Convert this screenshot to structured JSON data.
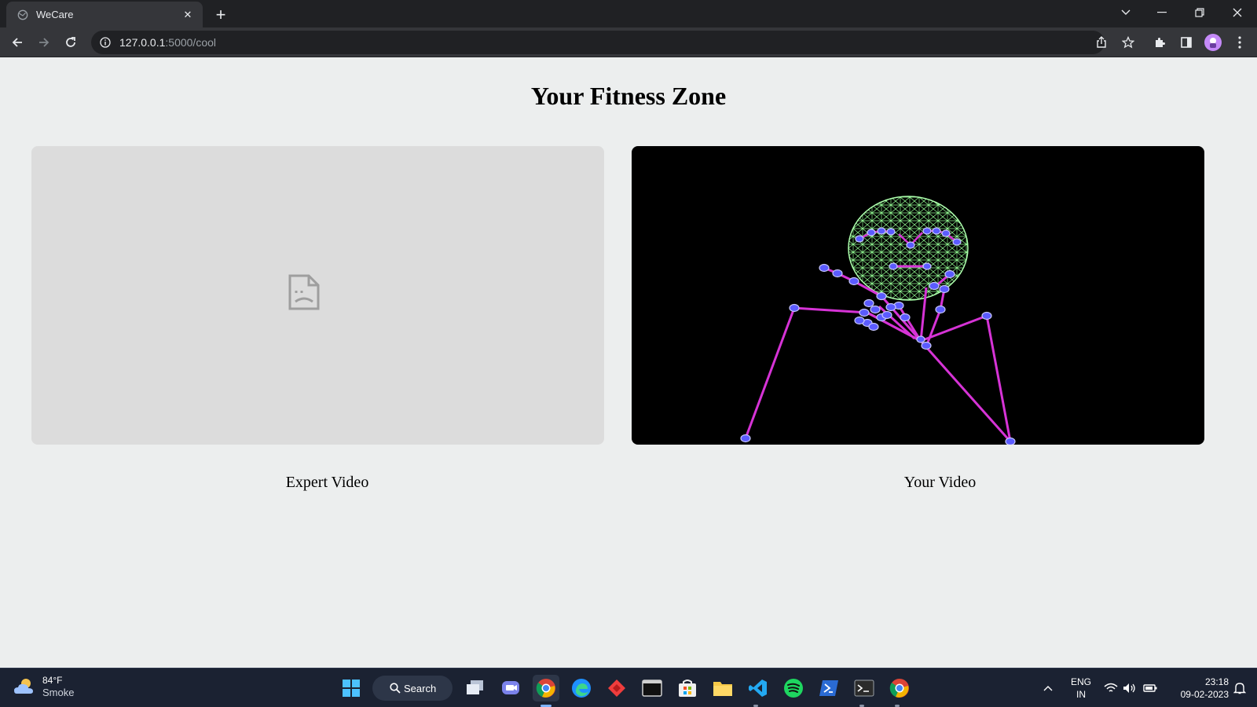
{
  "browser": {
    "tab_title": "WeCare",
    "url_host": "127.0.0.1",
    "url_path": ":5000/cool"
  },
  "page": {
    "title": "Your Fitness Zone",
    "panels": [
      {
        "caption": "Expert Video"
      },
      {
        "caption": "Your Video"
      }
    ]
  },
  "taskbar": {
    "weather_temp": "84°F",
    "weather_condition": "Smoke",
    "search_label": "Search",
    "language_line1": "ENG",
    "language_line2": "IN",
    "time": "23:18",
    "date": "09-02-2023"
  },
  "colors": {
    "page_bg": "#eceeee",
    "skeleton_line": "#d633d6",
    "keypoint": "#5b5bff",
    "face_mesh": "#8ff58f"
  }
}
